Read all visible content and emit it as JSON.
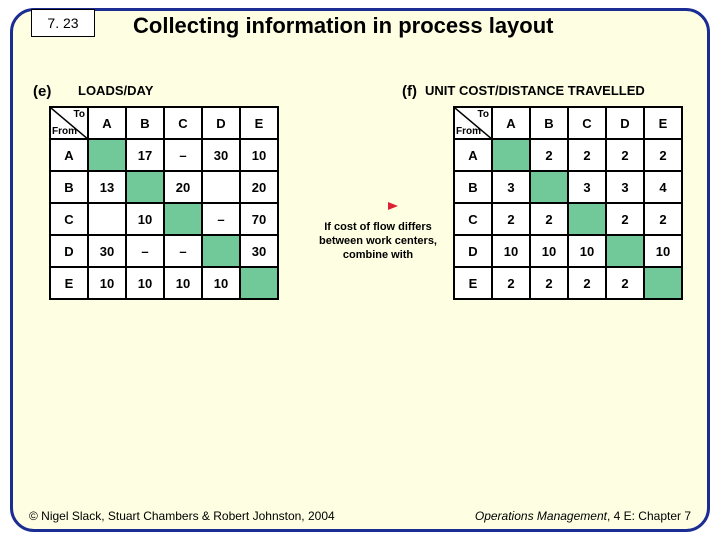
{
  "slide_number": "7. 23",
  "title": "Collecting information in process layout",
  "labels": {
    "e": "(e)",
    "f": "(f)",
    "to": "To",
    "from": "From"
  },
  "caption_e": "LOADS/DAY",
  "caption_f": "UNIT COST/DISTANCE TRAVELLED",
  "cols": [
    "A",
    "B",
    "C",
    "D",
    "E"
  ],
  "rows": [
    "A",
    "B",
    "C",
    "D",
    "E"
  ],
  "table_e": {
    "A": {
      "A": "",
      "B": "17",
      "C": "–",
      "D": "30",
      "E": "10"
    },
    "B": {
      "A": "13",
      "B": "",
      "C": "20",
      "D": "",
      "E": "20"
    },
    "C": {
      "A": "",
      "B": "10",
      "C": "",
      "D": "–",
      "E": "70"
    },
    "D": {
      "A": "30",
      "B": "–",
      "C": "–",
      "D": "",
      "E": "30"
    },
    "E": {
      "A": "10",
      "B": "10",
      "C": "10",
      "D": "10",
      "E": ""
    }
  },
  "table_f": {
    "A": {
      "A": "",
      "B": "2",
      "C": "2",
      "D": "2",
      "E": "2"
    },
    "B": {
      "A": "3",
      "B": "",
      "C": "3",
      "D": "3",
      "E": "4"
    },
    "C": {
      "A": "2",
      "B": "2",
      "C": "",
      "D": "2",
      "E": "2"
    },
    "D": {
      "A": "10",
      "B": "10",
      "C": "10",
      "D": "",
      "E": "10"
    },
    "E": {
      "A": "2",
      "B": "2",
      "C": "2",
      "D": "2",
      "E": ""
    }
  },
  "mid_text": "If cost of flow differs between work centers, combine with",
  "footer_left": "© Nigel Slack, Stuart Chambers & Robert Johnston, 2004",
  "footer_right_a": "Operations Management",
  "footer_right_b": ", 4 E: Chapter 7",
  "chart_data": [
    {
      "type": "table",
      "title": "LOADS/DAY",
      "rows": [
        "A",
        "B",
        "C",
        "D",
        "E"
      ],
      "cols": [
        "A",
        "B",
        "C",
        "D",
        "E"
      ],
      "values": [
        [
          null,
          17,
          null,
          30,
          10
        ],
        [
          13,
          null,
          20,
          null,
          20
        ],
        [
          null,
          10,
          null,
          null,
          70
        ],
        [
          30,
          null,
          null,
          null,
          30
        ],
        [
          10,
          10,
          10,
          10,
          null
        ]
      ]
    },
    {
      "type": "table",
      "title": "UNIT COST/DISTANCE TRAVELLED",
      "rows": [
        "A",
        "B",
        "C",
        "D",
        "E"
      ],
      "cols": [
        "A",
        "B",
        "C",
        "D",
        "E"
      ],
      "values": [
        [
          null,
          2,
          2,
          2,
          2
        ],
        [
          3,
          null,
          3,
          3,
          4
        ],
        [
          2,
          2,
          null,
          2,
          2
        ],
        [
          10,
          10,
          10,
          null,
          10
        ],
        [
          2,
          2,
          2,
          2,
          null
        ]
      ]
    }
  ]
}
